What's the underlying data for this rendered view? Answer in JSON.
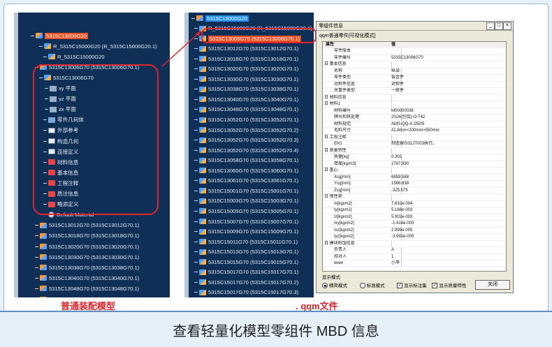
{
  "caption": "查看轻量化模型零组件 MBD 信息",
  "labels": {
    "left": "普通装配模型",
    "mid": ". qqm文件"
  },
  "left_tree": [
    {
      "text": "5315C15000G20",
      "icon": "asm",
      "sel": "orange"
    },
    {
      "text": "R_5315C15000G20 (R_5315C15000G20.1)",
      "icon": "part"
    },
    {
      "text": "R_5315C15000G20",
      "icon": "part"
    },
    {
      "text": "5315C13006G70 (5315C13006G70.1)",
      "icon": "asm"
    },
    {
      "text": "5315C13006G70",
      "icon": "part"
    },
    {
      "text": "xy 平面",
      "icon": "plane"
    },
    {
      "text": "yz 平面",
      "icon": "plane"
    },
    {
      "text": "zx 平面",
      "icon": "plane"
    },
    {
      "text": "零件几何体",
      "icon": "geo"
    },
    {
      "text": "外部参考",
      "icon": "box"
    },
    {
      "text": "构造几何",
      "icon": "box"
    },
    {
      "text": "连接定义",
      "icon": "box"
    },
    {
      "text": "材料信息",
      "icon": "red"
    },
    {
      "text": "基本信息",
      "icon": "red"
    },
    {
      "text": "工程注释",
      "icon": "red"
    },
    {
      "text": "质注信息",
      "icon": "red"
    },
    {
      "text": "略添定义",
      "icon": "red"
    },
    {
      "text": "Default Material",
      "icon": "mat"
    },
    {
      "text": "5315C13012G70 (5315C13012G70.1)",
      "icon": "asm"
    },
    {
      "text": "5315C13018G70 (5315C13018G70.1)",
      "icon": "asm"
    },
    {
      "text": "5315C13020G70 (5315C13020G70.1)",
      "icon": "asm"
    },
    {
      "text": "5315C13030G70 (5313C13030G70.1)",
      "icon": "asm"
    },
    {
      "text": "5315C13038G70 (5315C13038G70.1)",
      "icon": "asm"
    },
    {
      "text": "5315C13040G70 (5315C13040G70.1)",
      "icon": "asm"
    },
    {
      "text": "5315C13048G70 (5315C13048G70.1)",
      "icon": "asm"
    },
    {
      "text": "5315C13052G70 (5315C13052G70.1)",
      "icon": "asm"
    }
  ],
  "mid_tree": [
    {
      "text": "5315C15000G20",
      "sel": "blue"
    },
    {
      "text": "R_5315C15000G20 (R_5315C15000G20.1)"
    },
    {
      "text": "5315C13006G70 (5315C13006G70.1)",
      "sel": "orange"
    },
    {
      "text": "5315C13012G70 (5315C13012G70.1)"
    },
    {
      "text": "5315C13018G70 (5315C13018G70.1)"
    },
    {
      "text": "5315C13020G70 (5315C13020G70.1)"
    },
    {
      "text": "5315C13030G70 (5315C13030G70.1)"
    },
    {
      "text": "5315C13038G70 (5315C13038G70.1)"
    },
    {
      "text": "5315C13040G70 (5315C13040G70.1)"
    },
    {
      "text": "5315C13048G70 (5315C13048G70.1)"
    },
    {
      "text": "5315C13052G70 (5315C13052G70.1)"
    },
    {
      "text": "5315C13052G70 (5315C13052G70.2)"
    },
    {
      "text": "5315C13052G70 (5315C13052G70.3)"
    },
    {
      "text": "5315C13052G70 (5315C13052G70.4)"
    },
    {
      "text": "5315C13058G70 (5315C13058G70.1)"
    },
    {
      "text": "5315C13060G70 (5315C13060G70.1)"
    },
    {
      "text": "5315C13061G70 (5315C13061G70.1)"
    },
    {
      "text": "5315C15001G70 (5315C15001G70.1)"
    },
    {
      "text": "5315C15003G70 (5315C15003G70.1)"
    },
    {
      "text": "5315C15005G70 (5315C15005G70.1)"
    },
    {
      "text": "5315C15007G70 (5315C15007G70.1)"
    },
    {
      "text": "5315C15009G70 (5315C15009G70.1)"
    },
    {
      "text": "5315C15011G70 (5315C15011G70.1)"
    },
    {
      "text": "5315C15013G70 (5315C15013G70.1)"
    },
    {
      "text": "5315C15015G70 (5315C15015G70.1)"
    },
    {
      "text": "5315C15017G70 (5315C15017G70.1)"
    },
    {
      "text": "5315C15017G70 (5315C15017G70.2)"
    },
    {
      "text": "5315C15017G70 (5315C15017G70.3)"
    }
  ],
  "dialog": {
    "title": "零组件信息",
    "subtitle": "qqm普通零件[可视化模式]",
    "columns": [
      "属性",
      "值"
    ],
    "rows": [
      [
        "零件版本",
        ""
      ],
      [
        "零件编号",
        "5315C13006G70"
      ],
      [
        "日 基本信息",
        ""
      ],
      [
        "名称",
        "纵梁"
      ],
      [
        "零件类型",
        "钣金件"
      ],
      [
        "对称件信息",
        "对称件"
      ],
      [
        "关重件类型",
        "一般件"
      ],
      [
        "日 材料信息",
        ""
      ],
      [
        "日 材料1",
        ""
      ],
      [
        "材料编号",
        "M00000038"
      ],
      [
        "牌号和热处理",
        "2024(包铝)-O-T42"
      ],
      [
        "材料规范",
        "AMS-QQ-A-250/5"
      ],
      [
        "毛料尺寸",
        "δ1.8mm×200mm×550mm"
      ],
      [
        "日 工程注释",
        ""
      ],
      [
        "EN1",
        "制造按IS31JT003执行。"
      ],
      [
        "日 质量特性",
        ""
      ],
      [
        "质量[kg]",
        "0.302"
      ],
      [
        "密度[kg/m3]",
        "2767.990"
      ],
      [
        "日 重心",
        ""
      ],
      [
        "Xcg[mm]",
        "6859.588"
      ],
      [
        "Ycg[mm]",
        "1566.838"
      ],
      [
        "Zcg[mm]",
        "-325.575"
      ],
      [
        "日 惯性矩",
        ""
      ],
      [
        "Ix[kgxm2]",
        "7.632e-004"
      ],
      [
        "Iy[kgxm2]",
        "5.168e-003"
      ],
      [
        "Iz[kgxm2]",
        "5.902e-003"
      ],
      [
        "Ixy[kgxm2]",
        "-1.414e-003"
      ],
      [
        "Ixz[kgxm2]",
        "2.999e-005"
      ],
      [
        "Iyz[kgxm2]",
        "-3.992e-005"
      ],
      [
        "日 模块附加信息",
        ""
      ],
      [
        "负责人",
        "A"
      ],
      [
        "校对人",
        "1"
      ],
      [
        "www",
        "小李"
      ]
    ],
    "display_mode_label": "显示模式",
    "opt_precise": "精简模式",
    "opt_standard": "标准模式",
    "chk_annot": "显示标注集",
    "chk_mass": "显示质量特性",
    "close": "关闭"
  }
}
